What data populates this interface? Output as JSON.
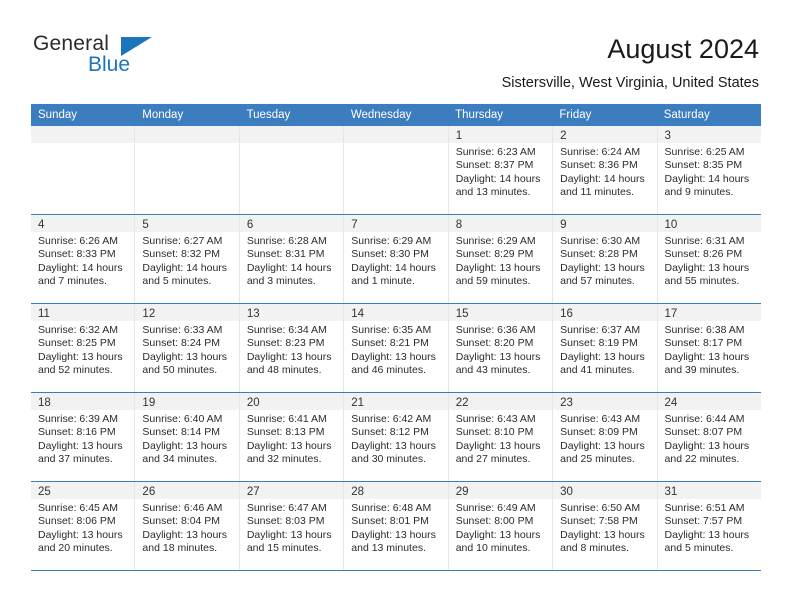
{
  "brand": {
    "name_part1": "General",
    "name_part2": "Blue",
    "triangle_color": "#1b75bb"
  },
  "header": {
    "title": "August 2024",
    "subtitle": "Sistersville, West Virginia, United States"
  },
  "calendar": {
    "header_color": "#3b7dbf",
    "weekdays": [
      "Sunday",
      "Monday",
      "Tuesday",
      "Wednesday",
      "Thursday",
      "Friday",
      "Saturday"
    ],
    "labels": {
      "sunrise": "Sunrise:",
      "sunset": "Sunset:",
      "daylight": "Daylight:"
    },
    "weeks": [
      [
        {
          "day": "",
          "sunrise": "",
          "sunset": "",
          "daylight_line1": "",
          "daylight_line2": "",
          "empty": true
        },
        {
          "day": "",
          "sunrise": "",
          "sunset": "",
          "daylight_line1": "",
          "daylight_line2": "",
          "empty": true
        },
        {
          "day": "",
          "sunrise": "",
          "sunset": "",
          "daylight_line1": "",
          "daylight_line2": "",
          "empty": true
        },
        {
          "day": "",
          "sunrise": "",
          "sunset": "",
          "daylight_line1": "",
          "daylight_line2": "",
          "empty": true
        },
        {
          "day": "1",
          "sunrise": "Sunrise: 6:23 AM",
          "sunset": "Sunset: 8:37 PM",
          "daylight_line1": "Daylight: 14 hours",
          "daylight_line2": "and 13 minutes."
        },
        {
          "day": "2",
          "sunrise": "Sunrise: 6:24 AM",
          "sunset": "Sunset: 8:36 PM",
          "daylight_line1": "Daylight: 14 hours",
          "daylight_line2": "and 11 minutes."
        },
        {
          "day": "3",
          "sunrise": "Sunrise: 6:25 AM",
          "sunset": "Sunset: 8:35 PM",
          "daylight_line1": "Daylight: 14 hours",
          "daylight_line2": "and 9 minutes."
        }
      ],
      [
        {
          "day": "4",
          "sunrise": "Sunrise: 6:26 AM",
          "sunset": "Sunset: 8:33 PM",
          "daylight_line1": "Daylight: 14 hours",
          "daylight_line2": "and 7 minutes."
        },
        {
          "day": "5",
          "sunrise": "Sunrise: 6:27 AM",
          "sunset": "Sunset: 8:32 PM",
          "daylight_line1": "Daylight: 14 hours",
          "daylight_line2": "and 5 minutes."
        },
        {
          "day": "6",
          "sunrise": "Sunrise: 6:28 AM",
          "sunset": "Sunset: 8:31 PM",
          "daylight_line1": "Daylight: 14 hours",
          "daylight_line2": "and 3 minutes."
        },
        {
          "day": "7",
          "sunrise": "Sunrise: 6:29 AM",
          "sunset": "Sunset: 8:30 PM",
          "daylight_line1": "Daylight: 14 hours",
          "daylight_line2": "and 1 minute."
        },
        {
          "day": "8",
          "sunrise": "Sunrise: 6:29 AM",
          "sunset": "Sunset: 8:29 PM",
          "daylight_line1": "Daylight: 13 hours",
          "daylight_line2": "and 59 minutes."
        },
        {
          "day": "9",
          "sunrise": "Sunrise: 6:30 AM",
          "sunset": "Sunset: 8:28 PM",
          "daylight_line1": "Daylight: 13 hours",
          "daylight_line2": "and 57 minutes."
        },
        {
          "day": "10",
          "sunrise": "Sunrise: 6:31 AM",
          "sunset": "Sunset: 8:26 PM",
          "daylight_line1": "Daylight: 13 hours",
          "daylight_line2": "and 55 minutes."
        }
      ],
      [
        {
          "day": "11",
          "sunrise": "Sunrise: 6:32 AM",
          "sunset": "Sunset: 8:25 PM",
          "daylight_line1": "Daylight: 13 hours",
          "daylight_line2": "and 52 minutes."
        },
        {
          "day": "12",
          "sunrise": "Sunrise: 6:33 AM",
          "sunset": "Sunset: 8:24 PM",
          "daylight_line1": "Daylight: 13 hours",
          "daylight_line2": "and 50 minutes."
        },
        {
          "day": "13",
          "sunrise": "Sunrise: 6:34 AM",
          "sunset": "Sunset: 8:23 PM",
          "daylight_line1": "Daylight: 13 hours",
          "daylight_line2": "and 48 minutes."
        },
        {
          "day": "14",
          "sunrise": "Sunrise: 6:35 AM",
          "sunset": "Sunset: 8:21 PM",
          "daylight_line1": "Daylight: 13 hours",
          "daylight_line2": "and 46 minutes."
        },
        {
          "day": "15",
          "sunrise": "Sunrise: 6:36 AM",
          "sunset": "Sunset: 8:20 PM",
          "daylight_line1": "Daylight: 13 hours",
          "daylight_line2": "and 43 minutes."
        },
        {
          "day": "16",
          "sunrise": "Sunrise: 6:37 AM",
          "sunset": "Sunset: 8:19 PM",
          "daylight_line1": "Daylight: 13 hours",
          "daylight_line2": "and 41 minutes."
        },
        {
          "day": "17",
          "sunrise": "Sunrise: 6:38 AM",
          "sunset": "Sunset: 8:17 PM",
          "daylight_line1": "Daylight: 13 hours",
          "daylight_line2": "and 39 minutes."
        }
      ],
      [
        {
          "day": "18",
          "sunrise": "Sunrise: 6:39 AM",
          "sunset": "Sunset: 8:16 PM",
          "daylight_line1": "Daylight: 13 hours",
          "daylight_line2": "and 37 minutes."
        },
        {
          "day": "19",
          "sunrise": "Sunrise: 6:40 AM",
          "sunset": "Sunset: 8:14 PM",
          "daylight_line1": "Daylight: 13 hours",
          "daylight_line2": "and 34 minutes."
        },
        {
          "day": "20",
          "sunrise": "Sunrise: 6:41 AM",
          "sunset": "Sunset: 8:13 PM",
          "daylight_line1": "Daylight: 13 hours",
          "daylight_line2": "and 32 minutes."
        },
        {
          "day": "21",
          "sunrise": "Sunrise: 6:42 AM",
          "sunset": "Sunset: 8:12 PM",
          "daylight_line1": "Daylight: 13 hours",
          "daylight_line2": "and 30 minutes."
        },
        {
          "day": "22",
          "sunrise": "Sunrise: 6:43 AM",
          "sunset": "Sunset: 8:10 PM",
          "daylight_line1": "Daylight: 13 hours",
          "daylight_line2": "and 27 minutes."
        },
        {
          "day": "23",
          "sunrise": "Sunrise: 6:43 AM",
          "sunset": "Sunset: 8:09 PM",
          "daylight_line1": "Daylight: 13 hours",
          "daylight_line2": "and 25 minutes."
        },
        {
          "day": "24",
          "sunrise": "Sunrise: 6:44 AM",
          "sunset": "Sunset: 8:07 PM",
          "daylight_line1": "Daylight: 13 hours",
          "daylight_line2": "and 22 minutes."
        }
      ],
      [
        {
          "day": "25",
          "sunrise": "Sunrise: 6:45 AM",
          "sunset": "Sunset: 8:06 PM",
          "daylight_line1": "Daylight: 13 hours",
          "daylight_line2": "and 20 minutes."
        },
        {
          "day": "26",
          "sunrise": "Sunrise: 6:46 AM",
          "sunset": "Sunset: 8:04 PM",
          "daylight_line1": "Daylight: 13 hours",
          "daylight_line2": "and 18 minutes."
        },
        {
          "day": "27",
          "sunrise": "Sunrise: 6:47 AM",
          "sunset": "Sunset: 8:03 PM",
          "daylight_line1": "Daylight: 13 hours",
          "daylight_line2": "and 15 minutes."
        },
        {
          "day": "28",
          "sunrise": "Sunrise: 6:48 AM",
          "sunset": "Sunset: 8:01 PM",
          "daylight_line1": "Daylight: 13 hours",
          "daylight_line2": "and 13 minutes."
        },
        {
          "day": "29",
          "sunrise": "Sunrise: 6:49 AM",
          "sunset": "Sunset: 8:00 PM",
          "daylight_line1": "Daylight: 13 hours",
          "daylight_line2": "and 10 minutes."
        },
        {
          "day": "30",
          "sunrise": "Sunrise: 6:50 AM",
          "sunset": "Sunset: 7:58 PM",
          "daylight_line1": "Daylight: 13 hours",
          "daylight_line2": "and 8 minutes."
        },
        {
          "day": "31",
          "sunrise": "Sunrise: 6:51 AM",
          "sunset": "Sunset: 7:57 PM",
          "daylight_line1": "Daylight: 13 hours",
          "daylight_line2": "and 5 minutes."
        }
      ]
    ]
  }
}
